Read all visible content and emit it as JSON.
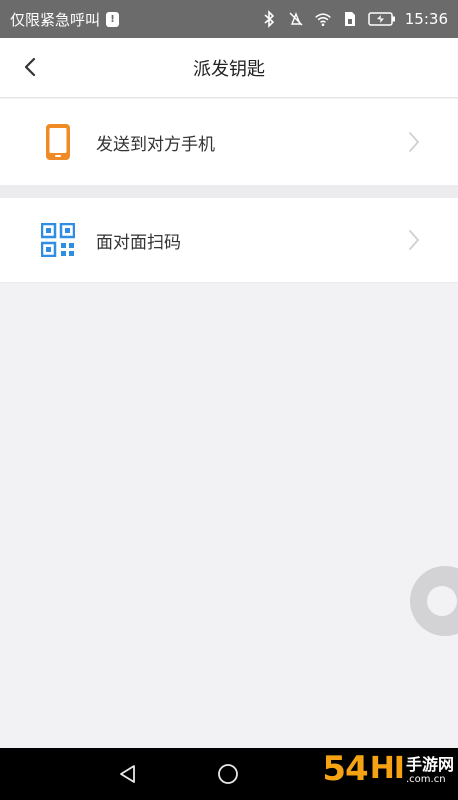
{
  "status_bar": {
    "carrier": "仅限紧急呼叫",
    "time": "15:36",
    "icons": [
      "bluetooth-icon",
      "vibrate-off-icon",
      "wifi-icon",
      "sim-icon",
      "battery-icon"
    ]
  },
  "header": {
    "title": "派发钥匙",
    "back_icon": "chevron-left-icon"
  },
  "options": [
    {
      "label": "发送到对方手机",
      "icon": "phone-icon",
      "color": "#f08a24"
    },
    {
      "label": "面对面扫码",
      "icon": "qr-code-icon",
      "color": "#2f8de4"
    }
  ],
  "nav_bar": {
    "buttons": [
      "back-triangle-icon",
      "home-circle-icon"
    ]
  },
  "watermark": {
    "number": "54",
    "suffix": "HI",
    "name": "手游网",
    "url": ".com.cn"
  }
}
